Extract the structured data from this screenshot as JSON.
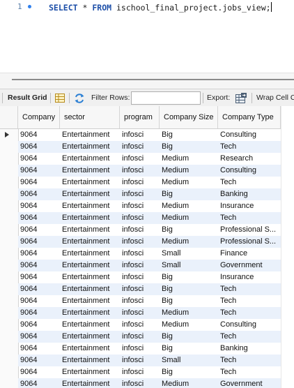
{
  "editor": {
    "line_number": "1",
    "sql_keyword_1": "SELECT",
    "sql_star": "*",
    "sql_keyword_2": "FROM",
    "sql_table": "ischool_final_project.jobs_view;"
  },
  "toolbar": {
    "result_grid_label": "Result Grid",
    "filter_rows_label": "Filter Rows:",
    "filter_rows_value": "",
    "export_label": "Export:",
    "wrap_cell_label": "Wrap Cell C"
  },
  "grid": {
    "columns": [
      {
        "label": "Company"
      },
      {
        "label": "sector"
      },
      {
        "label": "program"
      },
      {
        "label": "Company Size"
      },
      {
        "label": "Company Type"
      }
    ],
    "rows": [
      [
        "9064",
        "Entertainment",
        "infosci",
        "Big",
        "Consulting"
      ],
      [
        "9064",
        "Entertainment",
        "infosci",
        "Big",
        "Tech"
      ],
      [
        "9064",
        "Entertainment",
        "infosci",
        "Medium",
        "Research"
      ],
      [
        "9064",
        "Entertainment",
        "infosci",
        "Medium",
        "Consulting"
      ],
      [
        "9064",
        "Entertainment",
        "infosci",
        "Medium",
        "Tech"
      ],
      [
        "9064",
        "Entertainment",
        "infosci",
        "Big",
        "Banking"
      ],
      [
        "9064",
        "Entertainment",
        "infosci",
        "Medium",
        "Insurance"
      ],
      [
        "9064",
        "Entertainment",
        "infosci",
        "Medium",
        "Tech"
      ],
      [
        "9064",
        "Entertainment",
        "infosci",
        "Big",
        "Professional S..."
      ],
      [
        "9064",
        "Entertainment",
        "infosci",
        "Medium",
        "Professional S..."
      ],
      [
        "9064",
        "Entertainment",
        "infosci",
        "Small",
        "Finance"
      ],
      [
        "9064",
        "Entertainment",
        "infosci",
        "Small",
        "Government"
      ],
      [
        "9064",
        "Entertainment",
        "infosci",
        "Big",
        "Insurance"
      ],
      [
        "9064",
        "Entertainment",
        "infosci",
        "Big",
        "Tech"
      ],
      [
        "9064",
        "Entertainment",
        "infosci",
        "Big",
        "Tech"
      ],
      [
        "9064",
        "Entertainment",
        "infosci",
        "Medium",
        "Tech"
      ],
      [
        "9064",
        "Entertainment",
        "infosci",
        "Medium",
        "Consulting"
      ],
      [
        "9064",
        "Entertainment",
        "infosci",
        "Big",
        "Tech"
      ],
      [
        "9064",
        "Entertainment",
        "infosci",
        "Big",
        "Banking"
      ],
      [
        "9064",
        "Entertainment",
        "infosci",
        "Small",
        "Tech"
      ],
      [
        "9064",
        "Entertainment",
        "infosci",
        "Big",
        "Tech"
      ],
      [
        "9064",
        "Entertainment",
        "infosci",
        "Medium",
        "Government"
      ]
    ],
    "selected_row": 0
  },
  "colors": {
    "keyword": "#1d4fa8",
    "alt_row": "#eaf1fb",
    "line_dot": "#2f80ed"
  },
  "icons": [
    "grid-view-icon",
    "refresh-icon",
    "export-icon",
    "row-pointer-icon"
  ]
}
